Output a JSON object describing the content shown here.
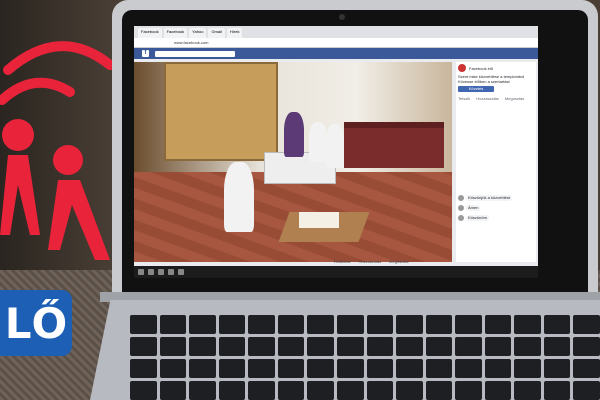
{
  "badge": {
    "text": "LŐ"
  },
  "browser": {
    "tabs": [
      "Facebook",
      "Facebook",
      "Yahoo",
      "Gmail",
      "Hírek"
    ],
    "address": "www.facebook.com"
  },
  "taskbar": {
    "time": ""
  },
  "video": {
    "controls": [
      "Reakciók",
      "Hozzászólás",
      "Megosztás"
    ]
  },
  "side_panel": {
    "page_name": "Facebook élő",
    "post_text": [
      "Szent mise közvetítése a templomból",
      "Kövesse élőben a szertartást"
    ],
    "button_label": "Követés",
    "actions": [
      "Tetszik",
      "Hozzászólás",
      "Megosztás"
    ],
    "comments": [
      {
        "author": "",
        "text": "Köszönjük a közvetítést"
      },
      {
        "author": "",
        "text": "Ámen"
      },
      {
        "author": "",
        "text": "Köszönöm"
      }
    ]
  },
  "colors": {
    "logo_red": "#e8233a",
    "badge_blue": "#1d5fb5",
    "facebook_blue": "#3b5998"
  }
}
